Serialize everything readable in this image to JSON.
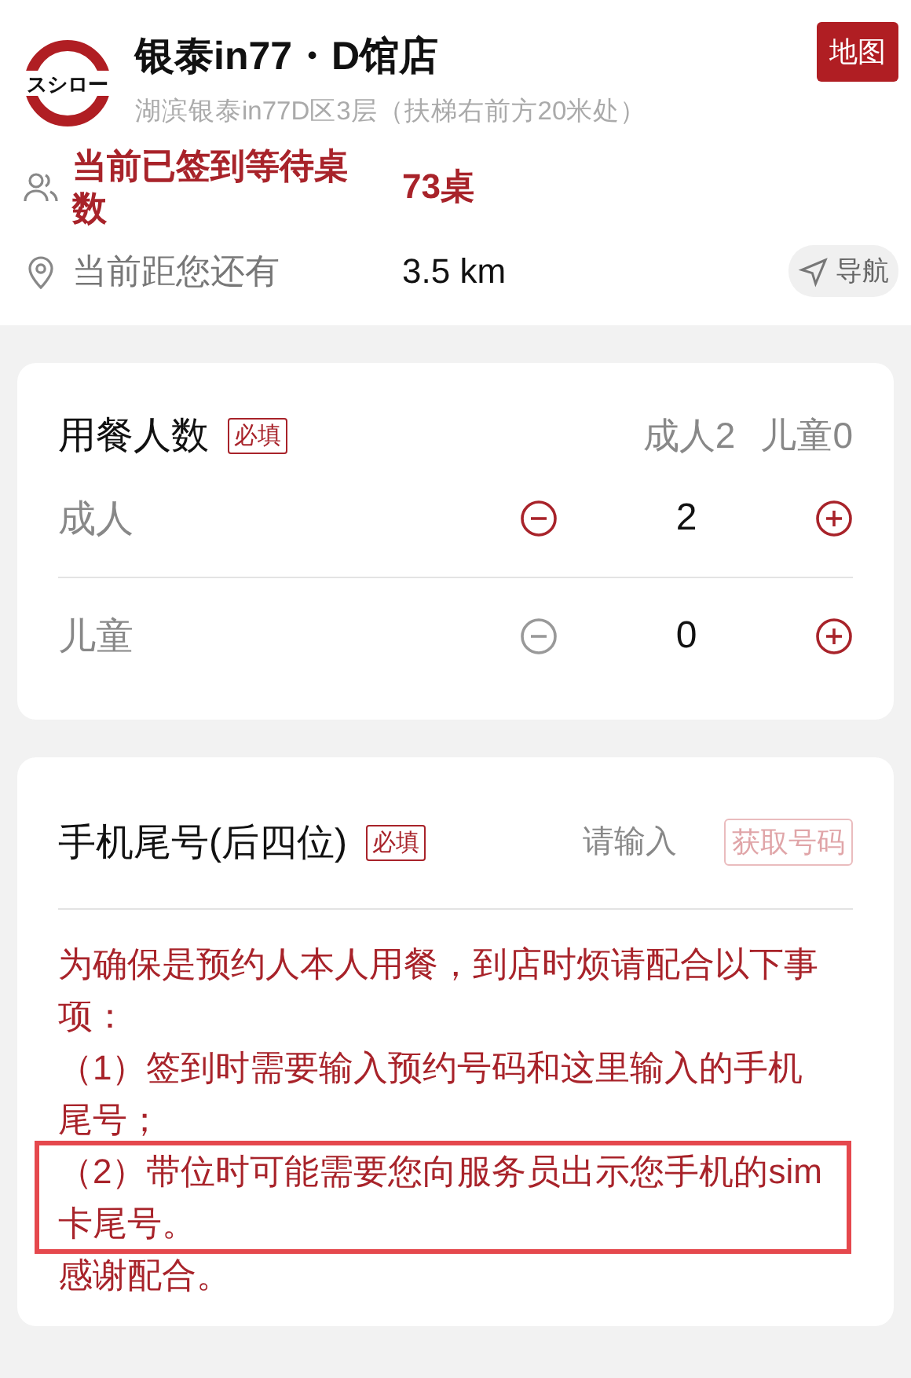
{
  "store": {
    "logo_text": "スシロー",
    "name": "银泰in77・D馆店",
    "address": "湖滨银泰in77D区3层（扶梯右前方20米处）",
    "map_button": "地图"
  },
  "info_rows": [
    {
      "kind": "queue",
      "label": "当前已签到等待桌数",
      "value": "73桌"
    },
    {
      "kind": "distance",
      "label": "当前距您还有",
      "value": "3.5 km",
      "action": "导航"
    }
  ],
  "party": {
    "title": "用餐人数",
    "required": "必填",
    "summary": [
      "成人2",
      "儿童0"
    ],
    "counters": [
      {
        "label": "成人",
        "value": "2",
        "decrement_disabled": false
      },
      {
        "label": "儿童",
        "value": "0",
        "decrement_disabled": true
      }
    ]
  },
  "phone": {
    "title": "手机尾号(后四位)",
    "required": "必填",
    "placeholder": "请输入",
    "code_button": "获取号码",
    "code_button_disabled": true,
    "notes": [
      {
        "text": "为确保是预约人本人用餐，到店时烦请配合以下事项：",
        "highlighted": false
      },
      {
        "text": "（1）签到时需要输入预约号码和这里输入的手机尾号；",
        "highlighted": false
      },
      {
        "text": "（2）带位时可能需要您向服务员出示您手机的sim卡尾号。",
        "highlighted": true
      },
      {
        "text": "感谢配合。",
        "highlighted": false
      }
    ]
  }
}
